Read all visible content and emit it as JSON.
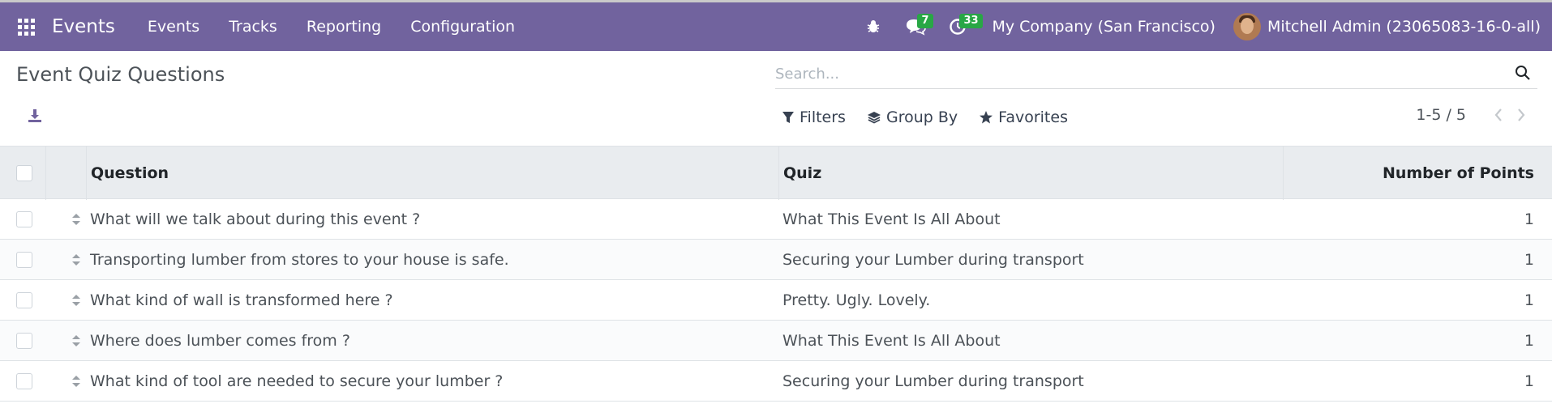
{
  "navbar": {
    "app_name": "Events",
    "menu": [
      "Events",
      "Tracks",
      "Reporting",
      "Configuration"
    ],
    "icons": [
      "apps-grid-icon",
      "bug-icon",
      "chat-icon",
      "clock-icon"
    ],
    "messages_count": "7",
    "activities_count": "33",
    "company": "My Company (San Francisco)",
    "user": "Mitchell Admin (23065083-16-0-all)",
    "badge_color": "#28a745",
    "bg_color": "#71639e"
  },
  "control": {
    "title": "Event Quiz Questions",
    "search_placeholder": "Search...",
    "filters": "Filters",
    "group_by": "Group By",
    "favorites": "Favorites",
    "pager": "1-5 / 5"
  },
  "table": {
    "columns": {
      "question": "Question",
      "quiz": "Quiz",
      "points": "Number of Points"
    },
    "rows": [
      {
        "question": "What will we talk about during this event ?",
        "quiz": "What This Event Is All About",
        "points": "1"
      },
      {
        "question": "Transporting lumber from stores to your house is safe.",
        "quiz": "Securing your Lumber during transport",
        "points": "1"
      },
      {
        "question": "What kind of wall is transformed here ?",
        "quiz": "Pretty. Ugly. Lovely.",
        "points": "1"
      },
      {
        "question": "Where does lumber comes from ?",
        "quiz": "What This Event Is All About",
        "points": "1"
      },
      {
        "question": "What kind of tool are needed to secure your lumber ?",
        "quiz": "Securing your Lumber during transport",
        "points": "1"
      }
    ]
  }
}
